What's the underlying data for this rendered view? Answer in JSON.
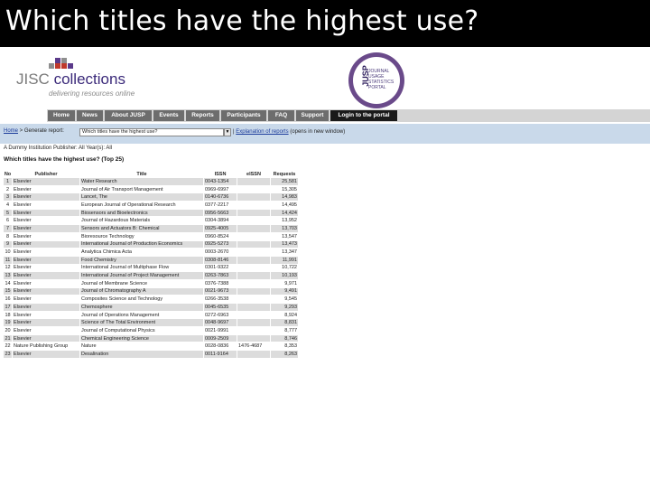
{
  "slide": {
    "title": "Which titles have the highest use?"
  },
  "jisc": {
    "part1": "JISC",
    "part2": "collections",
    "tagline": "delivering resources online",
    "colors": {
      "squares_a": "#c0392b",
      "squares_b": "#8e8e8e",
      "squares_c": "#5b3a8a"
    }
  },
  "jusp": {
    "word": "JUSP",
    "lines": [
      "JOURNAL",
      "USAGE",
      "STATISTICS",
      "PORTAL"
    ]
  },
  "nav": {
    "items": [
      "Home",
      "News",
      "About JUSP",
      "Events",
      "Reports",
      "Participants",
      "FAQ",
      "Support",
      "Login to the portal"
    ]
  },
  "report": {
    "breadcrumb_home": "Home",
    "breadcrumb_rest": " > Generate report:",
    "select_value": "Which titles have the highest use?",
    "explain_link": "Explanation of reports",
    "explain_note": " (opens in new window)",
    "filter": "A Dummy Institution  Publisher: All  Year(s): All",
    "heading": "Which titles have the highest use? (Top 25)"
  },
  "table": {
    "headers": [
      "No",
      "Publisher",
      "Title",
      "ISSN",
      "eISSN",
      "Requests"
    ],
    "rows": [
      [
        "1",
        "Elsevier",
        "Water Research",
        "0043-1354",
        "",
        "25,581"
      ],
      [
        "2",
        "Elsevier",
        "Journal of Air Transport Management",
        "0969-6997",
        "",
        "15,305"
      ],
      [
        "3",
        "Elsevier",
        "Lancet, The",
        "0140-6736",
        "",
        "14,983"
      ],
      [
        "4",
        "Elsevier",
        "European Journal of Operational Research",
        "0377-2217",
        "",
        "14,495"
      ],
      [
        "5",
        "Elsevier",
        "Biosensors and Bioelectronics",
        "0956-5663",
        "",
        "14,424"
      ],
      [
        "6",
        "Elsevier",
        "Journal of Hazardous Materials",
        "0304-3894",
        "",
        "13,952"
      ],
      [
        "7",
        "Elsevier",
        "Sensors and Actuators B: Chemical",
        "0925-4005",
        "",
        "13,703"
      ],
      [
        "8",
        "Elsevier",
        "Bioresource Technology",
        "0960-8524",
        "",
        "13,547"
      ],
      [
        "9",
        "Elsevier",
        "International Journal of Production Economics",
        "0925-5273",
        "",
        "13,473"
      ],
      [
        "10",
        "Elsevier",
        "Analytica Chimica Acta",
        "0003-2670",
        "",
        "13,347"
      ],
      [
        "11",
        "Elsevier",
        "Food Chemistry",
        "0308-8146",
        "",
        "11,991"
      ],
      [
        "12",
        "Elsevier",
        "International Journal of Multiphase Flow",
        "0301-9322",
        "",
        "10,722"
      ],
      [
        "13",
        "Elsevier",
        "International Journal of Project Management",
        "0263-7863",
        "",
        "10,193"
      ],
      [
        "14",
        "Elsevier",
        "Journal of Membrane Science",
        "0376-7388",
        "",
        "9,971"
      ],
      [
        "15",
        "Elsevier",
        "Journal of Chromatography A",
        "0021-9673",
        "",
        "9,491"
      ],
      [
        "16",
        "Elsevier",
        "Composites Science and Technology",
        "0266-3538",
        "",
        "9,545"
      ],
      [
        "17",
        "Elsevier",
        "Chemosphere",
        "0045-6535",
        "",
        "9,293"
      ],
      [
        "18",
        "Elsevier",
        "Journal of Operations Management",
        "0272-6963",
        "",
        "8,924"
      ],
      [
        "19",
        "Elsevier",
        "Science of The Total Environment",
        "0048-9697",
        "",
        "8,831"
      ],
      [
        "20",
        "Elsevier",
        "Journal of Computational Physics",
        "0021-9991",
        "",
        "8,777"
      ],
      [
        "21",
        "Elsevier",
        "Chemical Engineering Science",
        "0009-2509",
        "",
        "8,746"
      ],
      [
        "22",
        "Nature Publishing Group",
        "Nature",
        "0028-0836",
        "1476-4687",
        "8,353"
      ],
      [
        "23",
        "Elsevier",
        "Desalination",
        "0011-9164",
        "",
        "8,263"
      ]
    ]
  }
}
